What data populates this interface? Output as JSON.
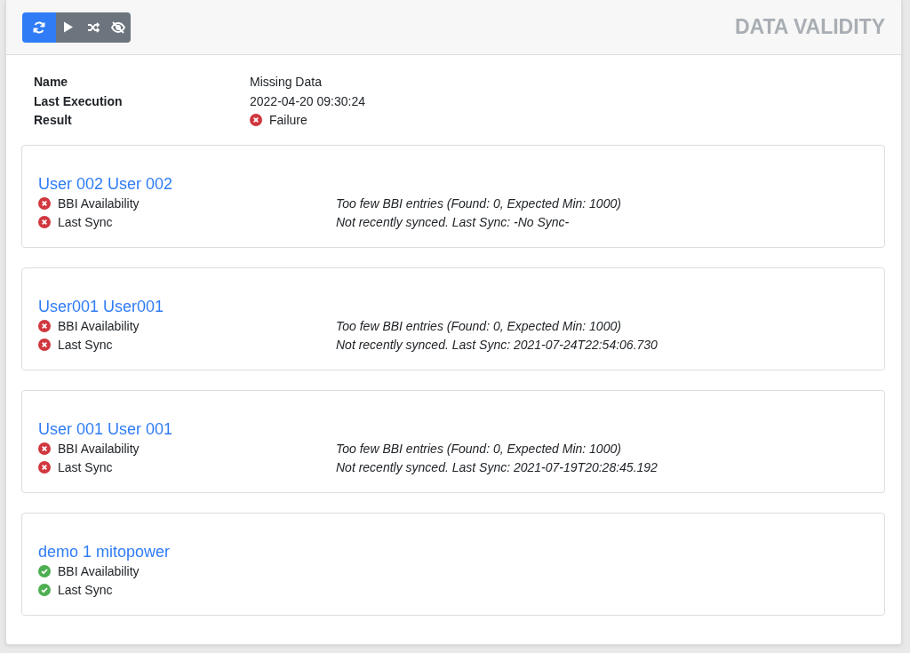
{
  "toolbar": [
    {
      "kind": "refresh",
      "selected": true
    },
    {
      "kind": "play",
      "selected": false
    },
    {
      "kind": "shuffle",
      "selected": false
    },
    {
      "kind": "hide",
      "selected": false
    }
  ],
  "title": "DATA VALIDITY",
  "info": [
    {
      "label": "Name",
      "value": "Missing Data"
    },
    {
      "label": "Last Execution",
      "value": "2022-04-20 09:30:24"
    },
    {
      "label": "Result",
      "value": "Failure",
      "passed": false
    }
  ],
  "users": [
    {
      "name": "User 002 User 002",
      "checks": [
        {
          "label": "BBI Availability",
          "passed": false,
          "message": "Too few BBI entries (Found: 0, Expected Min: 1000)"
        },
        {
          "label": "Last Sync",
          "passed": false,
          "message": "Not recently synced. Last Sync: -No Sync-"
        }
      ]
    },
    {
      "name": "User001 User001",
      "checks": [
        {
          "label": "BBI Availability",
          "passed": false,
          "message": "Too few BBI entries (Found: 0, Expected Min: 1000)"
        },
        {
          "label": "Last Sync",
          "passed": false,
          "message": "Not recently synced. Last Sync: 2021-07-24T22:54:06.730"
        }
      ]
    },
    {
      "name": "User 001 User 001",
      "checks": [
        {
          "label": "BBI Availability",
          "passed": false,
          "message": "Too few BBI entries (Found: 0, Expected Min: 1000)"
        },
        {
          "label": "Last Sync",
          "passed": false,
          "message": "Not recently synced. Last Sync: 2021-07-19T20:28:45.192"
        }
      ]
    },
    {
      "name": "demo 1 mitopower",
      "checks": [
        {
          "label": "BBI Availability",
          "passed": true
        },
        {
          "label": "Last Sync",
          "passed": true
        }
      ]
    }
  ]
}
